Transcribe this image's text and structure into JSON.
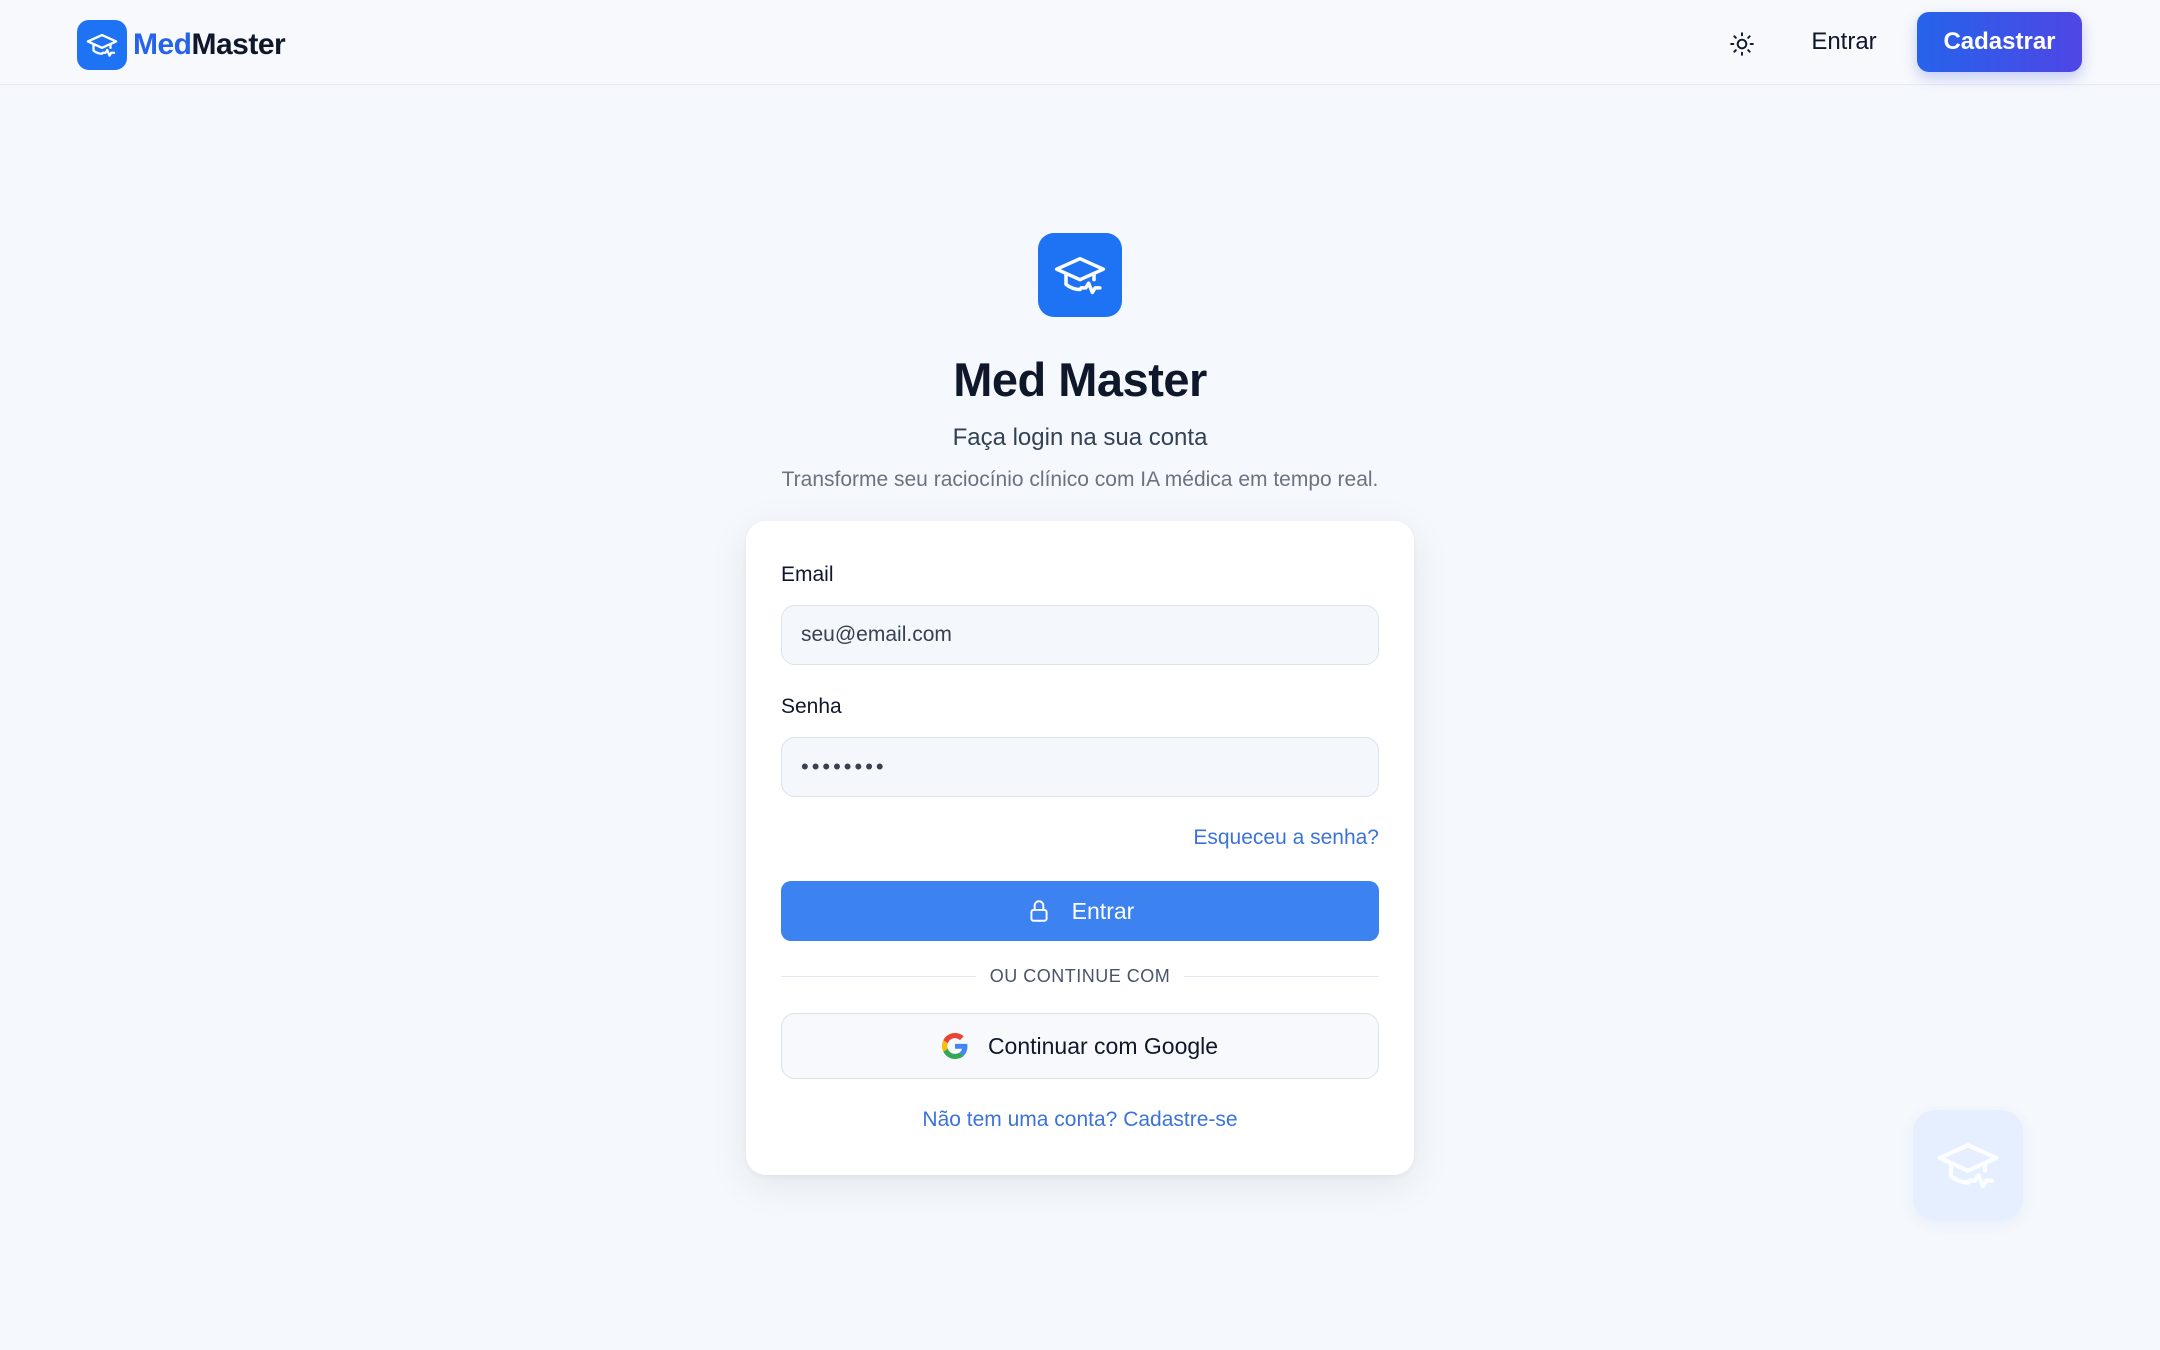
{
  "header": {
    "brand_part1": "Med",
    "brand_part2": "Master",
    "theme_icon": "sun-icon",
    "login_label": "Entrar",
    "signup_label": "Cadastrar"
  },
  "hero": {
    "title": "Med Master",
    "subtitle": "Faça login na sua conta",
    "tagline": "Transforme seu raciocínio clínico com IA médica em tempo real."
  },
  "form": {
    "email_label": "Email",
    "email_value": "seu@email.com",
    "password_label": "Senha",
    "password_value": "••••••••",
    "forgot_label": "Esqueceu a senha?",
    "submit_label": "Entrar",
    "divider_text": "OU CONTINUE COM",
    "google_label": "Continuar com Google",
    "signup_prompt": "Não tem uma conta? Cadastre-se"
  },
  "colors": {
    "primary": "#1e73f5",
    "button": "#3c82f0",
    "link": "#3b73d9",
    "background": "#f5f8fc"
  }
}
